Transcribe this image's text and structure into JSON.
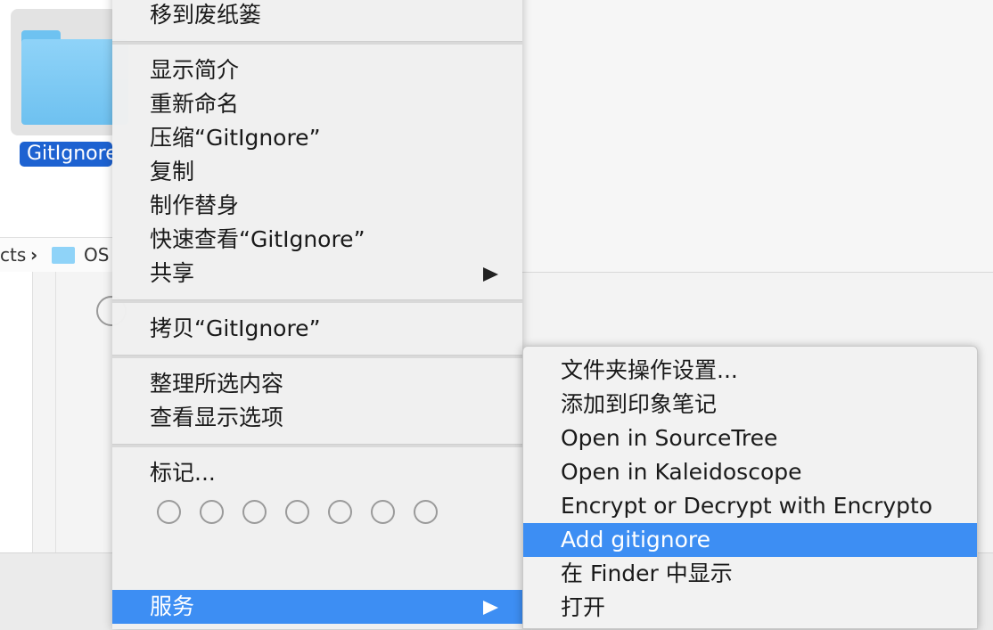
{
  "finder": {
    "selected_item_label": "GitIgnore",
    "path_segment_1": "cts",
    "path_separator": "›",
    "path_segment_2": "OS"
  },
  "context_menu": {
    "items": [
      {
        "label": "移到废纸篓",
        "has_submenu": false
      },
      {
        "label": "显示简介",
        "has_submenu": false
      },
      {
        "label": "重新命名",
        "has_submenu": false
      },
      {
        "label": "压缩“GitIgnore”",
        "has_submenu": false
      },
      {
        "label": "复制",
        "has_submenu": false
      },
      {
        "label": "制作替身",
        "has_submenu": false
      },
      {
        "label": "快速查看“GitIgnore”",
        "has_submenu": false
      },
      {
        "label": "共享",
        "has_submenu": true
      },
      {
        "label": "拷贝“GitIgnore”",
        "has_submenu": false
      },
      {
        "label": "整理所选内容",
        "has_submenu": false
      },
      {
        "label": "查看显示选项",
        "has_submenu": false
      },
      {
        "label": "标记...",
        "has_submenu": false
      },
      {
        "label": "服务",
        "has_submenu": true,
        "selected": true
      }
    ],
    "tag_colors": [
      "none",
      "none",
      "none",
      "none",
      "none",
      "none",
      "none"
    ]
  },
  "services_submenu": {
    "items": [
      {
        "label": "文件夹操作设置..."
      },
      {
        "label": "添加到印象笔记"
      },
      {
        "label": "Open in SourceTree"
      },
      {
        "label": "Open in Kaleidoscope"
      },
      {
        "label": "Encrypt or Decrypt with Encrypto"
      },
      {
        "label": "Add gitignore",
        "selected": true
      },
      {
        "label": "在 Finder 中显示"
      },
      {
        "label": "打开"
      }
    ]
  },
  "colors": {
    "selection_blue": "#3d8ef3",
    "finder_label_blue": "#1d62d1",
    "folder_blue": "#8fd3f8"
  }
}
